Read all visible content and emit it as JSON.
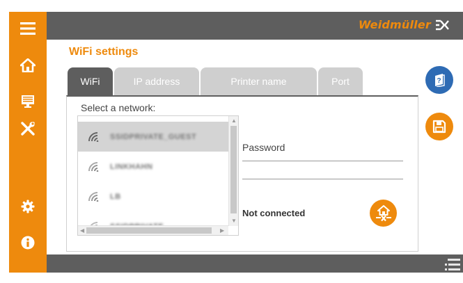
{
  "brand": {
    "name": "Weidmüller"
  },
  "page": {
    "title": "WiFi settings"
  },
  "tabs": [
    {
      "label": "WiFi",
      "active": true
    },
    {
      "label": "IP address",
      "active": false
    },
    {
      "label": "Printer name",
      "active": false
    },
    {
      "label": "Port",
      "active": false
    }
  ],
  "network": {
    "select_label": "Select a network:",
    "items": [
      {
        "name": "SSIDPRIVATE_GUEST",
        "selected": true,
        "icon": "wifi-icon"
      },
      {
        "name": "LINKHAHN",
        "selected": false,
        "icon": "wifi-icon"
      },
      {
        "name": "LB",
        "selected": false,
        "icon": "wifi-icon"
      },
      {
        "name": "SSIDPRIVATE",
        "selected": false,
        "icon": "wifi-icon"
      }
    ]
  },
  "password": {
    "label": "Password",
    "value": ""
  },
  "connection": {
    "status": "Not connected"
  },
  "sidebar": {
    "items": [
      "menu-icon",
      "home-icon",
      "monitor-icon",
      "tools-icon",
      "gear-icon",
      "info-icon"
    ]
  },
  "colors": {
    "accent": "#ee8a0d",
    "bar": "#5e5e5e",
    "help": "#2e6bb4",
    "tab_inactive": "#cfcfcf"
  }
}
